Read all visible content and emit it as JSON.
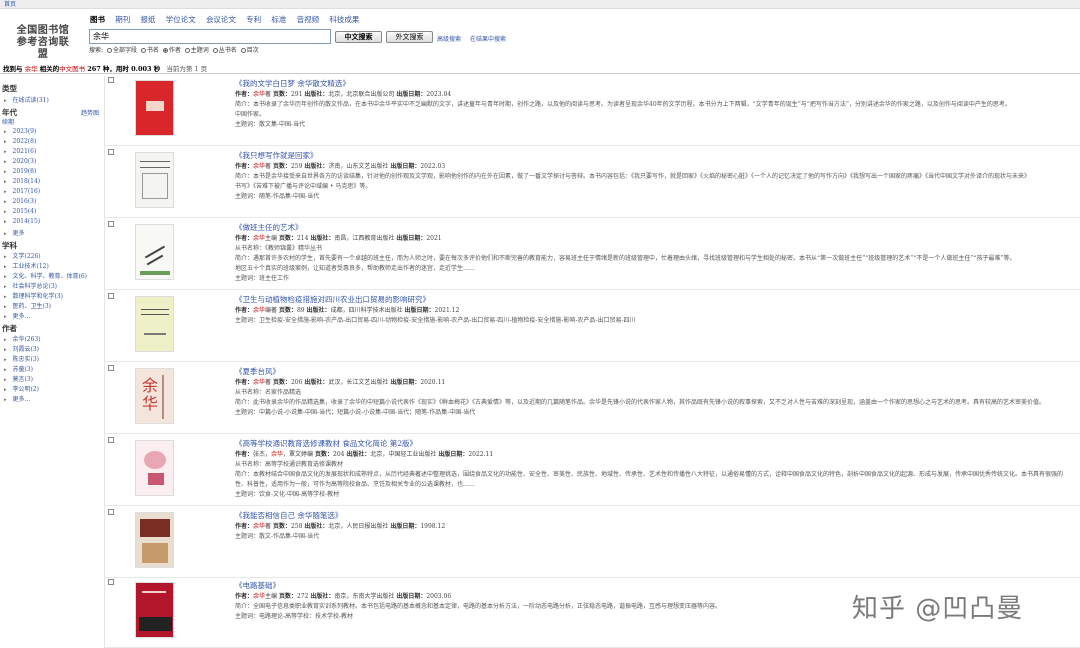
{
  "topbar": {
    "home_link": "首页"
  },
  "logo": {
    "line1": "全国图书馆",
    "line2": "参考咨询联盟"
  },
  "tabs": [
    "图书",
    "期刊",
    "报纸",
    "学位论文",
    "会议论文",
    "专利",
    "标准",
    "音视频",
    "科技成果"
  ],
  "search": {
    "value": "余华",
    "cn_button": "中文搜索",
    "en_button": "外文搜索",
    "advanced_link": "高级搜索",
    "in_results_link": "在结果中搜索"
  },
  "fields": {
    "label": "搜索:",
    "options": [
      "全部字段",
      "书名",
      "作者",
      "主题词",
      "丛书名",
      "目次"
    ],
    "selected": "作者"
  },
  "result_summary": {
    "prefix": "找到与",
    "keyword": "余华",
    "middle": "相关的",
    "type": "中文图书",
    "count": "267",
    "suffix": "种，用时 0.003 秒",
    "tip": "当前为第 1 页"
  },
  "sidebar": {
    "type_head": "类型",
    "type_items": [
      "在线试读(31)"
    ],
    "year_head": "年代",
    "year_trend": "趋势图",
    "year_sub": "续期",
    "year_items": [
      "2023(9)",
      "2022(8)",
      "2021(6)",
      "2020(3)",
      "2019(8)",
      "2018(14)",
      "2017(16)",
      "2016(3)",
      "2015(4)",
      "2014(15)",
      "更多"
    ],
    "subject_head": "学科",
    "subject_items": [
      "文学(226)",
      "工业技术(12)",
      "文化、科学、教育、体育(6)",
      "社会科学总论(3)",
      "数理科学和化学(3)",
      "医药、卫生(3)",
      "更多..."
    ],
    "author_head": "作者",
    "author_items": [
      "余华(263)",
      "刘霞云(3)",
      "陈忠实(3)",
      "苏童(3)",
      "莫言(3)",
      "李公明(2)",
      "更多..."
    ]
  },
  "results": [
    {
      "title": "《我的文学白日梦 余华散文精选》",
      "author": "余华著",
      "pages": "291",
      "publisher": "北京，北京联合出版公司",
      "date": "2023.04",
      "series": "",
      "intro": "简介：本书收录了余华历年创作的散文作品，在本书中余华平实中不乏幽默的文字，讲述童年与青年时期，创作之路，以及他的阅读与思考。为读者呈现余华40年的文学历程。本书分为上下两辑，“文学青年的诞生”与“把写作当方法”，分别讲述余华的作家之路，以及创作与阅读中产生的思考。",
      "intro2": "中国作家。",
      "subjects": "主题词：散文集-中国-当代"
    },
    {
      "title": "《我只想写作就是回家》",
      "author": "余华著",
      "pages": "259",
      "publisher": "济南，山东文艺出版社",
      "date": "2022.03",
      "series": "",
      "intro": "简介：本书是余华接受来自世界各方的访谈结集，针对他的创作观及文学观，影响他创作的内在外在因素，做了一番文学探讨与答辩。本书内容包括：《我只要写作，就是回家》《火焰的秘密心脏》《一个人的记忆决定了他的写作方向》《我想写出一个国家的疼痛》《当代中国文学对外译介的现状与未来》",
      "intro2": "书写》《苦难下被广播与评论中域编 • 马克思》等。",
      "subjects": "主题词：随笔-作品集-中国-当代"
    },
    {
      "title": "《做班主任的艺术》",
      "author": "余华主编",
      "pages": "214",
      "publisher": "南昌，江西教育出版社",
      "date": "2021",
      "series": "从书名称：《教师锦囊》精华丛书",
      "intro": "简介：遇那首许多农村的学生，首先要有一个卓越的班主任，而为人师之时，要在每次多评价他们和不断完善的教育能力，容易班主任于情绪是新的班级管理中，忙着理由头绪，寻找班级管理和与学生相处的秘密。本书从“第一次做班主任”“班级管理的艺术”“不是一个人做班主任”“孩子最难”等。",
      "intro2": "地区五十个真实的班级案例，让知道者受惠良多，帮助教师走出作者的迷宫，走近学生……",
      "subjects": "主题词：班主任工作"
    },
    {
      "title": "《卫生与动植物检疫措施对四川农业出口贸易的影响研究》",
      "author": "余华编著",
      "pages": "89",
      "publisher": "成都，四川科学技术出版社",
      "date": "2021.12",
      "series": "",
      "intro": "主题词：卫生检疫-安全措施-影响-农产品-出口贸易-四川-动物检疫-安全措施-影响-农产品-出口贸易-四川-植物检疫-安全措施-影响-农产品-出口贸易-四川",
      "intro2": "",
      "subjects": ""
    },
    {
      "title": "《夏季台风》",
      "author": "余华著",
      "pages": "206",
      "publisher": "武汉，长江文艺出版社",
      "date": "2020.11",
      "series": "从书名称：名家作品精选",
      "intro": "简介：此书收录余华的作品精选集，收录了余华的中短篇小说代表作《现实》《鲜血梅花》《古典爱情》等，以及近期的几篇随笔作品。余华是先锋小说的代表作家人物，其作品既有先锋小说的叙事探索，又不乏对人性与苦难的深刻呈现，涵盖由一个作家的思想心之与艺术的思考。具有较高的艺术审美价值。",
      "intro2": "主题词：中篇小说-小说集-中国-当代；短篇小说-小说集-中国-当代；随笔-作品集-中国-当代",
      "subjects": ""
    },
    {
      "title": "《高等学校通识教育选修课教材 食品文化简论 第2版》",
      "author": "张杰，余华，覃文婷编",
      "pages": "204",
      "publisher": "北京，中国轻工业出版社",
      "date": "2022.11",
      "series": "从书名称：高等学校通识教育选修课教材",
      "intro": "简介：本教材结合中国食品文化的发展现状和成熟特点，从历代经典著述中整理挑选，围绕食品文化的功能性、安全性、审美性、民族性、地域性、传承性、艺术性和传播性八大特征，以通俗易懂的方式，诠释中国食品文化的特色，剖析中国食品文化的起源、形成与发展，传承中国优秀传统文化。本书具有很强的",
      "intro2": "性、科普性，适用作为一般，可作为高等院校食品、烹饪及相关专业的公选课教材，也……",
      "subjects": "主题词：饮食-文化-中国-高等学校-教材"
    },
    {
      "title": "《我能否相信自己 余华随笔选》",
      "author": "余华著",
      "pages": "258",
      "publisher": "北京，人民日报出版社",
      "date": "1998.12",
      "series": "",
      "intro": "主题词：散文-作品集-中国-当代",
      "intro2": "",
      "subjects": ""
    },
    {
      "title": "《电路基础》",
      "author": "余华主编",
      "pages": "272",
      "publisher": "南京，东南大学出版社",
      "date": "2003.06",
      "series": "",
      "intro": "简介：全国电子信息类职业教育实训系列教材。本书包括电路的基本概念和基本定律，电路的基本分析方法，一阶动态电路分析，正弦稳态电路，谐振电路，互感与理想变压器等内容。",
      "intro2": "主题词：电路理论-高等学校：技术学校-教材",
      "subjects": ""
    }
  ],
  "labels": {
    "author": "作者：",
    "pages": "页数：",
    "publisher": "出版社：",
    "date": "出版日期："
  },
  "watermark": "知乎 @凹凸曼",
  "colors": {
    "link": "#3355aa",
    "keyword": "#cc0000",
    "topbar": "#eeeeee"
  }
}
